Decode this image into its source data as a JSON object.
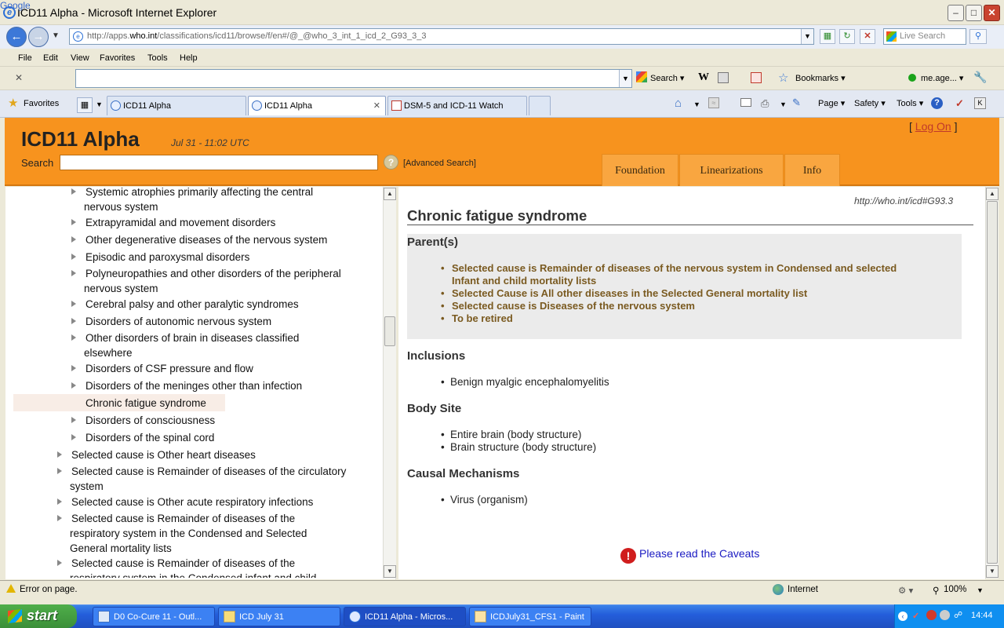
{
  "window": {
    "title": "ICD11 Alpha - Microsoft Internet Explorer"
  },
  "address": {
    "url_prefix": "http://apps.",
    "url_domain": "who.int",
    "url_rest": "/classifications/icd11/browse/f/en#/@_@who_3_int_1_icd_2_G93_3_3",
    "live_search_placeholder": "Live Search"
  },
  "menu": [
    "File",
    "Edit",
    "View",
    "Favorites",
    "Tools",
    "Help"
  ],
  "google_toolbar": {
    "logo": "Google",
    "search_label": "Search",
    "bookmarks_label": "Bookmarks",
    "account_label": "me.age..."
  },
  "tabs": {
    "favorites_label": "Favorites",
    "items": [
      {
        "label": "ICD11 Alpha"
      },
      {
        "label": "ICD11 Alpha"
      },
      {
        "label": "DSM-5 and ICD-11 Watch"
      }
    ],
    "commands": {
      "page": "Page",
      "safety": "Safety",
      "tools": "Tools"
    }
  },
  "header": {
    "brand": "ICD11 Alpha",
    "date": "Jul 31 - 11:02 UTC",
    "search_label": "Search",
    "advanced_search": "[Advanced Search]",
    "logon_open": "[",
    "logon": "Log On",
    "logon_close": "]",
    "nav": [
      "Foundation",
      "Linearizations",
      "Info"
    ]
  },
  "tree": [
    {
      "label": "Systemic atrophies primarily affecting the central",
      "cont": "nervous system"
    },
    {
      "label": "Extrapyramidal and movement disorders"
    },
    {
      "label": "Other degenerative diseases of the nervous system"
    },
    {
      "label": "Episodic and paroxysmal disorders"
    },
    {
      "label": "Polyneuropathies and other disorders of the peripheral",
      "cont": "nervous system"
    },
    {
      "label": "Cerebral palsy and other paralytic syndromes"
    },
    {
      "label": "Disorders of autonomic nervous system"
    },
    {
      "label": "Other disorders of brain in diseases classified",
      "cont": "elsewhere"
    },
    {
      "label": "Disorders of CSF pressure and flow"
    },
    {
      "label": "Disorders of the meninges other than infection"
    },
    {
      "label": "Chronic fatigue syndrome"
    },
    {
      "label": "Disorders of consciousness"
    },
    {
      "label": "Disorders of the spinal cord"
    },
    {
      "label": "Selected cause is Other heart diseases"
    },
    {
      "label": "Selected cause is Remainder of diseases of the circulatory",
      "cont": "system"
    },
    {
      "label": "Selected cause is Other acute respiratory infections"
    },
    {
      "label": "Selected cause is Remainder of diseases of the",
      "cont": "respiratory system in the Condensed and Selected",
      "cont2": "General mortality lists"
    },
    {
      "label": "Selected cause is Remainder of diseases of the",
      "cont": "respiratory system in the Condensed infant and child"
    }
  ],
  "detail": {
    "code_url": "http://who.int/icd#G93.3",
    "title": "Chronic fatigue syndrome",
    "parents_heading": "Parent(s)",
    "parents": [
      {
        "line1": "Selected cause is Remainder of diseases of the nervous system in Condensed and selected",
        "line2": "Infant and child mortality lists"
      },
      {
        "line1": "Selected Cause is All other diseases in the Selected General mortality list"
      },
      {
        "line1": "Selected cause is Diseases of the nervous system"
      },
      {
        "line1": "To be retired"
      }
    ],
    "inclusions_heading": "Inclusions",
    "inclusions": [
      "Benign myalgic encephalomyelitis"
    ],
    "body_site_heading": "Body Site",
    "body_sites": [
      "Entire brain (body structure)",
      "Brain structure (body structure)"
    ],
    "causal_heading": "Causal Mechanisms",
    "causal": [
      "Virus (organism)"
    ],
    "caveat_link": "Please read the Caveats"
  },
  "status": {
    "message": "Error on page.",
    "zone": "Internet",
    "zoom": "100%"
  },
  "taskbar": {
    "start": "start",
    "items": [
      {
        "label": "D0 Co-Cure 11 - Outl..."
      },
      {
        "label": "ICD July 31"
      },
      {
        "label": "ICD11 Alpha - Micros..."
      },
      {
        "label": "ICDJuly31_CFS1 - Paint"
      }
    ],
    "clock": "14:44"
  }
}
